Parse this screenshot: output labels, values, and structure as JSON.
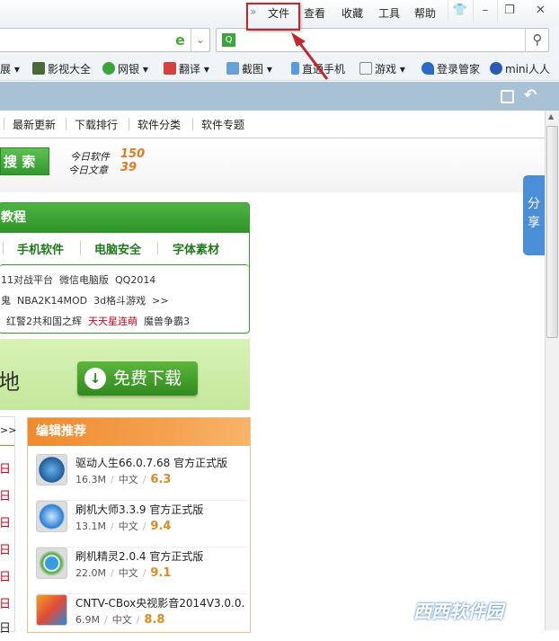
{
  "menubar": {
    "overflow": "»",
    "items": [
      "文件",
      "查看",
      "收藏",
      "工具",
      "帮助"
    ],
    "window_buttons": [
      "skin-icon",
      "minimize-icon",
      "restore-icon",
      "close-icon"
    ]
  },
  "highlight_color": "#c0282d",
  "bookmarks": {
    "items": [
      {
        "label": "展",
        "dropdown": true
      },
      {
        "label": "影视大全"
      },
      {
        "label": "网银",
        "dropdown": true
      },
      {
        "label": "翻译",
        "dropdown": true
      },
      {
        "label": "截图",
        "dropdown": true
      },
      {
        "label": "直通手机"
      },
      {
        "label": "游戏",
        "dropdown": true
      },
      {
        "label": "登录管家"
      },
      {
        "label": "mini人人"
      }
    ]
  },
  "nav": {
    "items": [
      "最新更新",
      "下载排行",
      "软件分类",
      "软件专题"
    ]
  },
  "search": {
    "button": "搜 索"
  },
  "stats": {
    "software_label": "今日软件",
    "software_value": "150",
    "article_label": "今日文章",
    "article_value": "39"
  },
  "share": {
    "label1": "分",
    "label2": "享"
  },
  "green_panel": {
    "title": "教程",
    "tabs": [
      "手机软件",
      "电脑安全",
      "字体素材"
    ],
    "links_row1": [
      "11对战平台",
      "微信电脑版",
      "QQ2014"
    ],
    "links_row2": [
      "鬼",
      "NBA2K14MOD",
      "3d格斗游戏",
      ">>"
    ],
    "links_row3": [
      {
        "text": "红警2共和国之辉",
        "hot": false
      },
      {
        "text": "天天星连萌",
        "hot": true
      },
      {
        "text": "魔兽争霸3",
        "hot": false
      }
    ]
  },
  "banner": {
    "text": "地",
    "button": "免费下载"
  },
  "left_list": {
    "more": ">>",
    "marks": [
      "日",
      "日",
      "日",
      "日",
      "日",
      "日",
      "日"
    ]
  },
  "recommend": {
    "title": "编辑推荐",
    "items": [
      {
        "name": "驱动人生66.0.7.68 官方正式版",
        "size": "16.3M",
        "lang": "中文",
        "score": "6.3",
        "icon_color": "#1f5d9c"
      },
      {
        "name": "刷机大师3.3.9 官方正式版",
        "size": "13.1M",
        "lang": "中文",
        "score": "9.4",
        "icon_color": "#2a7fd6"
      },
      {
        "name": "刷机精灵2.0.4 官方正式版",
        "size": "22.0M",
        "lang": "中文",
        "score": "9.1",
        "icon_color": "#4aa83a"
      },
      {
        "name": "CNTV-CBox央视影音2014V3.0.0.",
        "size": "6.9M",
        "lang": "中文",
        "score": "8.8",
        "icon_color": "#e04a3a"
      }
    ]
  },
  "watermark": "西西软件园"
}
